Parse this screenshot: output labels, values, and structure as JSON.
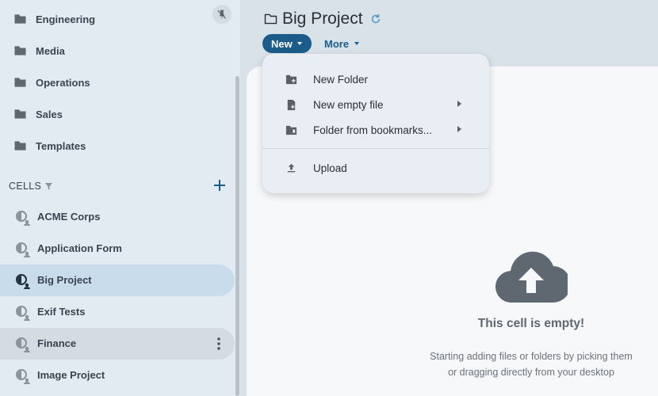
{
  "sidebar": {
    "folders": [
      {
        "label": "Engineering",
        "icon": "folder-icon"
      },
      {
        "label": "Media",
        "icon": "folder-icon"
      },
      {
        "label": "Operations",
        "icon": "folder-icon"
      },
      {
        "label": "Sales",
        "icon": "folder-icon"
      },
      {
        "label": "Templates",
        "icon": "folder-icon"
      }
    ],
    "cells_title": "CELLS",
    "cells": [
      {
        "label": "ACME Corps",
        "icon": "cell-icon"
      },
      {
        "label": "Application Form",
        "icon": "cell-icon"
      },
      {
        "label": "Big Project",
        "icon": "cell-icon",
        "state": "active"
      },
      {
        "label": "Exif Tests",
        "icon": "cell-icon"
      },
      {
        "label": "Finance",
        "icon": "cell-icon",
        "state": "hovered"
      },
      {
        "label": "Image Project",
        "icon": "cell-icon"
      }
    ]
  },
  "header": {
    "title": "Big Project",
    "new_label": "New",
    "more_label": "More"
  },
  "menu": {
    "items": [
      {
        "label": "New Folder",
        "icon": "new-folder-icon"
      },
      {
        "label": "New empty file",
        "icon": "new-file-icon",
        "submenu": true
      },
      {
        "label": "Folder from bookmarks...",
        "icon": "bookmark-folder-icon",
        "submenu": true
      },
      {
        "label": "Upload",
        "icon": "upload-icon"
      }
    ]
  },
  "empty_state": {
    "title": "This cell is empty!",
    "line1": "Starting adding files or folders by picking them",
    "line2": "or dragging directly from your desktop"
  },
  "colors": {
    "accent": "#1c5c8b",
    "sidebar_bg": "#e3ebf2",
    "active_item": "#c9dcec"
  }
}
